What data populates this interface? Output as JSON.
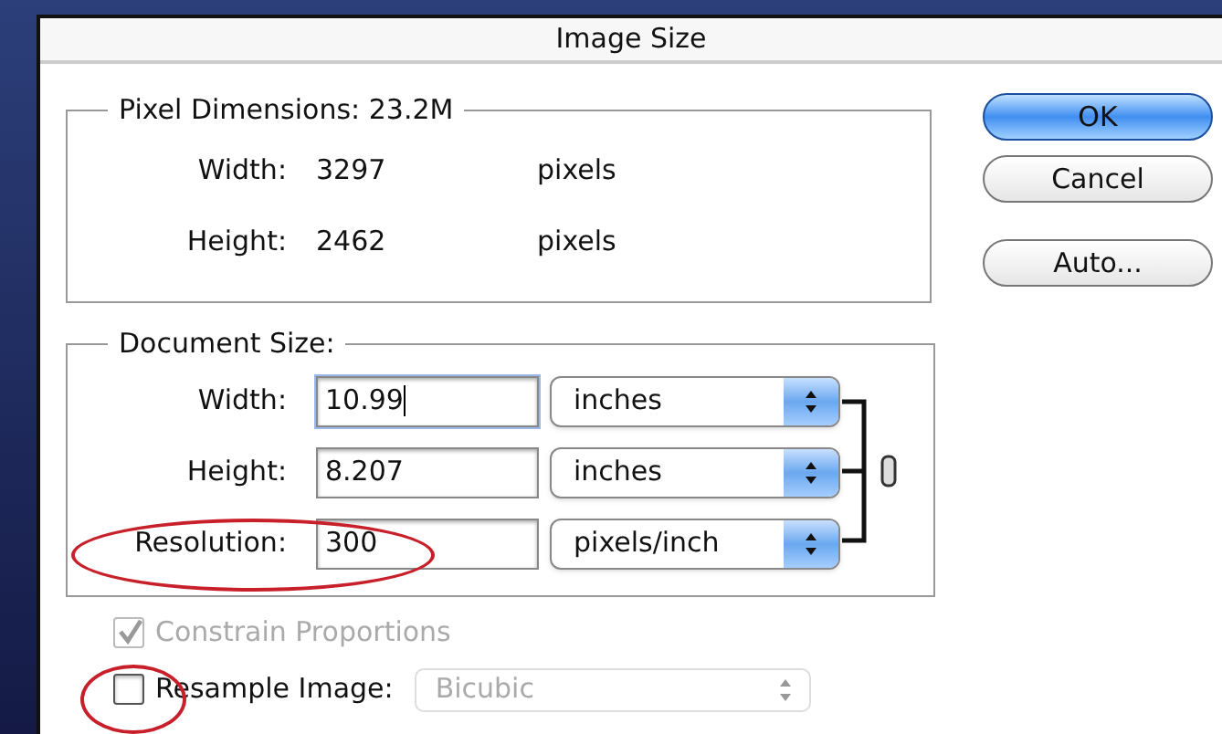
{
  "window": {
    "title": "Image Size"
  },
  "pixel_dimensions": {
    "label": "Pixel Dimensions:",
    "value": "23.2M",
    "rows": [
      {
        "label": "Width:",
        "value": "3297",
        "unit": "pixels"
      },
      {
        "label": "Height:",
        "value": "2462",
        "unit": "pixels"
      }
    ]
  },
  "document_size": {
    "label": "Document Size:",
    "rows": [
      {
        "label": "Width:",
        "value": "10.99",
        "unit": "inches",
        "focused": true
      },
      {
        "label": "Height:",
        "value": "8.207",
        "unit": "inches",
        "focused": false
      },
      {
        "label": "Resolution:",
        "value": "300",
        "unit": "pixels/inch",
        "focused": false
      }
    ]
  },
  "options": [
    {
      "label": "Constrain Proportions",
      "checked": true,
      "disabled": true
    },
    {
      "label": "Resample Image:",
      "checked": false,
      "disabled": false
    }
  ],
  "resample_method": {
    "value": "Bicubic",
    "disabled": true
  },
  "buttons": [
    {
      "label": "OK",
      "default": true
    },
    {
      "label": "Cancel",
      "default": false
    },
    {
      "label": "Auto...",
      "default": false
    }
  ]
}
